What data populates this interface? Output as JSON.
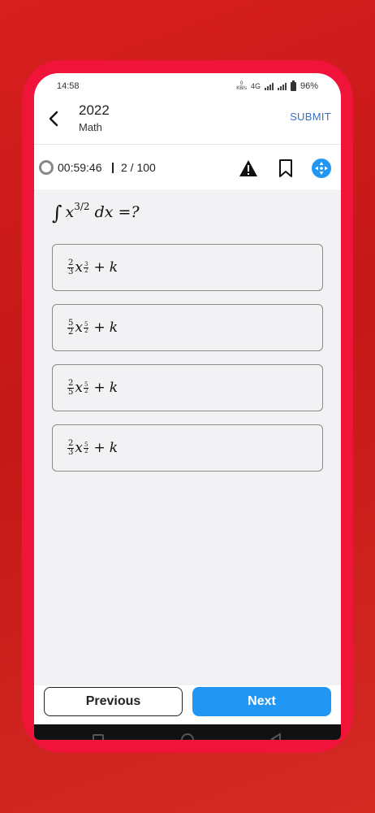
{
  "status_bar": {
    "time": "14:58",
    "network_speed_value": "0",
    "network_speed_unit": "KB/s",
    "network_type": "4G",
    "battery": "96%"
  },
  "header": {
    "year": "2022",
    "subject": "Math",
    "submit_label": "SUBMIT"
  },
  "toolbar": {
    "timer": "00:59:46",
    "counter": "2 / 100"
  },
  "question": {
    "var": "x",
    "exponent": "3/2",
    "tail": "dx =?"
  },
  "options": [
    {
      "coef_num": "2",
      "coef_den": "3",
      "var": "x",
      "exp_num": "3",
      "exp_den": "2",
      "const": "k"
    },
    {
      "coef_num": "5",
      "coef_den": "2",
      "var": "x",
      "exp_num": "5",
      "exp_den": "2",
      "const": "k"
    },
    {
      "coef_num": "2",
      "coef_den": "5",
      "var": "x",
      "exp_num": "5",
      "exp_den": "2",
      "const": "k"
    },
    {
      "coef_num": "2",
      "coef_den": "3",
      "var": "x",
      "exp_num": "5",
      "exp_den": "2",
      "const": "k"
    }
  ],
  "footer": {
    "previous_label": "Previous",
    "next_label": "Next"
  },
  "colors": {
    "accent": "#2196f3",
    "submit": "#3a6fc4",
    "frame": "#f0133a"
  },
  "icons": {
    "back": "chevron-left-icon",
    "timer": "timer-ring-icon",
    "report": "warning-icon",
    "bookmark": "bookmark-icon",
    "navigator": "navigation-icon"
  }
}
